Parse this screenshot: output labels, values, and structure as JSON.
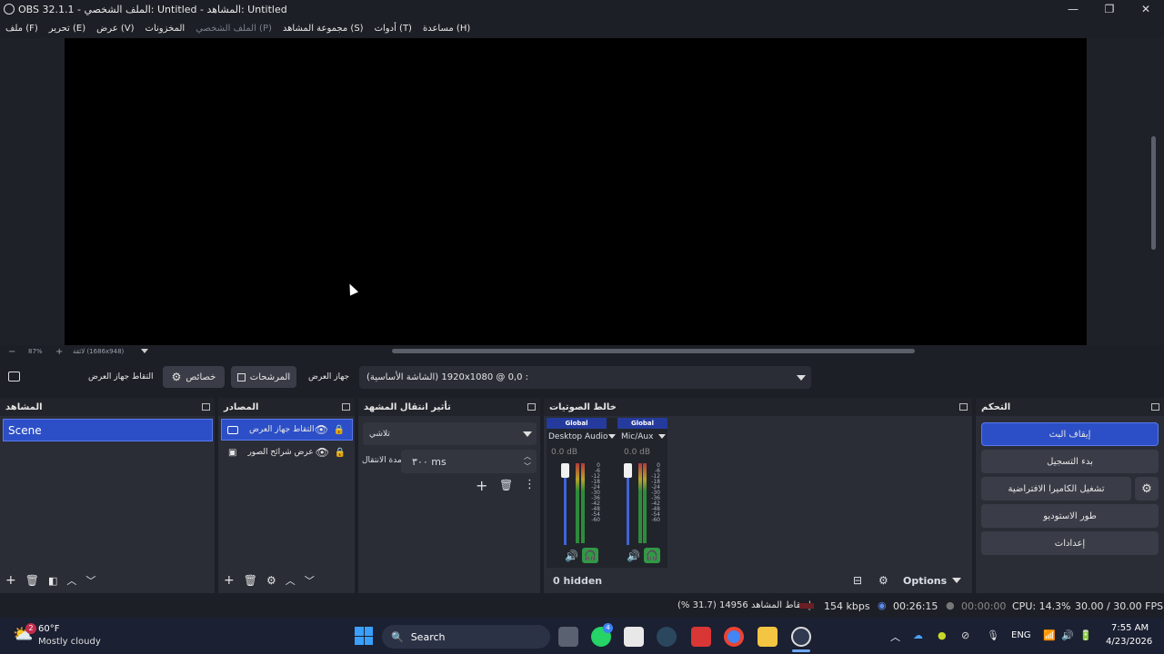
{
  "window": {
    "title": "OBS 32.1.1 - الملف الشخصي: Untitled - المشاهد: Untitled"
  },
  "menu": [
    "ملف (F)",
    "تحرير (E)",
    "عرض (V)",
    "المخزونات",
    "الملف الشخصي (P)",
    "مجموعة المشاهد (S)",
    "أدوات (T)",
    "مساعدة (H)"
  ],
  "zoom": {
    "minus": "−",
    "value": "87%",
    "plus": "+",
    "fit": "لائقة (1686x948)"
  },
  "source_toolbar": {
    "source_name": "التقاط جهاز العرض",
    "properties_label": "خصائص",
    "filters_label": "المرشحات",
    "display_label": "جهاز العرض",
    "display_value": "(الشاشة الأساسية) 1920x1080 @ 0,0 :"
  },
  "docks": {
    "scenes": {
      "title": "المشاهد",
      "items": [
        "Scene"
      ]
    },
    "sources": {
      "title": "المصادر",
      "items": [
        "التقاط جهاز العرض",
        "عرض شرائح الصور"
      ]
    },
    "transitions": {
      "title": "تأثير انتقال المشهد",
      "type": "تلاشي",
      "duration_label": "مدة الانتقال",
      "duration_value": "٣٠٠ ms"
    },
    "mixer": {
      "title": "خالط الصوتيات",
      "channels": [
        {
          "badge": "Global",
          "name": "Desktop Audio",
          "db": "0.0 dB"
        },
        {
          "badge": "Global",
          "name": "Mic/Aux",
          "db": "0.0 dB"
        }
      ],
      "ticks": [
        "0",
        "-6",
        "-12",
        "-18",
        "-24",
        "-30",
        "-36",
        "-42",
        "-48",
        "-54",
        "-60"
      ],
      "hidden": "0 hidden",
      "options": "Options"
    },
    "controls": {
      "title": "التحكم",
      "buttons": [
        "إيقاف البث",
        "بدء التسجيل",
        "تشغيل الكاميرا الافتراضية",
        "طور الاستوديو",
        "إعدادات"
      ]
    }
  },
  "status": {
    "dropped": "إسقاط المشاهد 14956 (31.7 %)",
    "bitrate": "154 kbps",
    "stream_time": "00:26:15",
    "rec_time": "00:00:00",
    "cpu": "CPU: 14.3%",
    "fps": "30.00 / 30.00 FPS"
  },
  "taskbar": {
    "weather_badge": "2",
    "temp": "60°F",
    "condition": "Mostly cloudy",
    "search": "Search",
    "whatsapp_badge": "4",
    "lang": "ENG",
    "time": "7:55 AM",
    "date": "4/23/2026"
  },
  "colors": {
    "accent": "#2c4fc7",
    "panel": "#2a2d36",
    "background": "#1d1f26"
  }
}
